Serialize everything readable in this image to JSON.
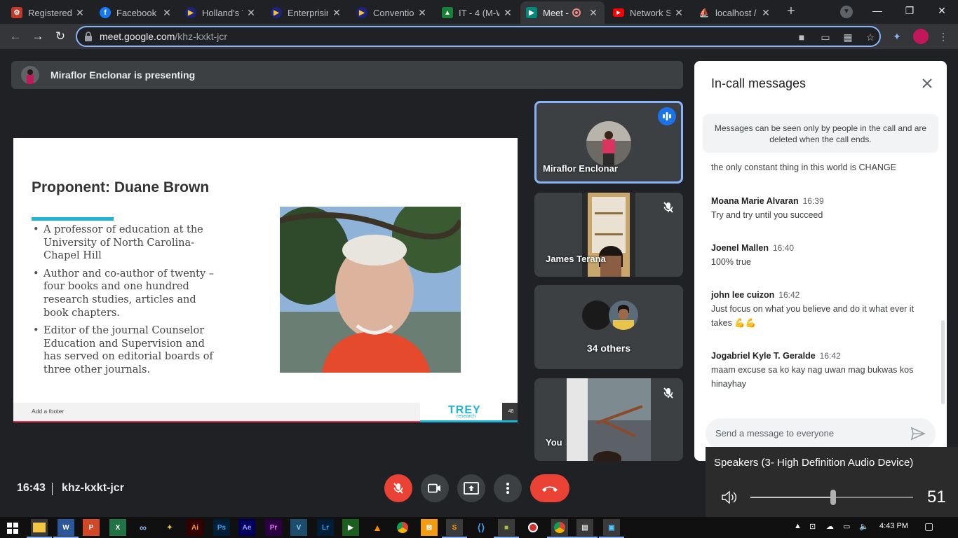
{
  "browser": {
    "tabs": [
      {
        "title": "Registered",
        "favicon": "registered-icon",
        "color": "#c0392b"
      },
      {
        "title": "Facebook",
        "favicon": "facebook-icon",
        "color": "#1877f2"
      },
      {
        "title": "Holland's T",
        "favicon": "playlist-icon",
        "color": "#1a237e"
      },
      {
        "title": "Enterprisin",
        "favicon": "playlist-icon",
        "color": "#1a237e"
      },
      {
        "title": "Convention",
        "favicon": "playlist-icon",
        "color": "#1a237e"
      },
      {
        "title": "IT - 4 (M-W",
        "favicon": "classroom-icon",
        "color": "#188038"
      },
      {
        "title": "Meet - ",
        "favicon": "meet-icon",
        "color": "#00897b"
      },
      {
        "title": "Network S",
        "favicon": "youtube-icon",
        "color": "#ff0000"
      },
      {
        "title": "localhost /",
        "favicon": "phpmyadmin-icon",
        "color": "#f29111"
      }
    ],
    "url_host": "meet.google.com",
    "url_path": "/khz-kxkt-jcr"
  },
  "meet": {
    "presenting_banner": "Miraflor Enclonar is presenting",
    "clock": "16:43",
    "meeting_code": "khz-kxkt-jcr",
    "tiles": {
      "presenter_name": "Miraflor Enclonar",
      "participant2_name": "James Terana",
      "others_label": "34 others",
      "self_label": "You"
    }
  },
  "slide": {
    "title": "Proponent: Duane Brown",
    "bullets": [
      "A professor of education at the University of North Carolina-Chapel Hill",
      "Author and co-author of twenty – four books and one hundred research studies, articles and book chapters.",
      "Editor of the journal Counselor Education and Supervision and has served on editorial boards of three other journals."
    ],
    "footer": "Add a footer",
    "logo_big": "TREY",
    "logo_small": "research",
    "page_number": "48"
  },
  "chat": {
    "header": "In-call messages",
    "notice": "Messages can be seen only by people in the call and are deleted when the call ends.",
    "partial_message": "the only constant thing in this world is CHANGE",
    "messages": [
      {
        "sender": "Moana Marie Alvaran",
        "time": "16:39",
        "text": "Try and try until you succeed"
      },
      {
        "sender": "Joenel Mallen",
        "time": "16:40",
        "text": "100% true"
      },
      {
        "sender": "john lee cuizon",
        "time": "16:42",
        "text": "Just focus on what you believe and do it what ever it takes 💪💪"
      },
      {
        "sender": "Jogabriel Kyle T. Geralde",
        "time": "16:42",
        "text": "maam excuse sa ko kay nag uwan mag bukwas kos hinayhay"
      }
    ],
    "input_placeholder": "Send a message to everyone"
  },
  "volume": {
    "device": "Speakers (3- High Definition Audio Device)",
    "level": 51
  },
  "taskbar": {
    "time": "4:43 PM"
  }
}
